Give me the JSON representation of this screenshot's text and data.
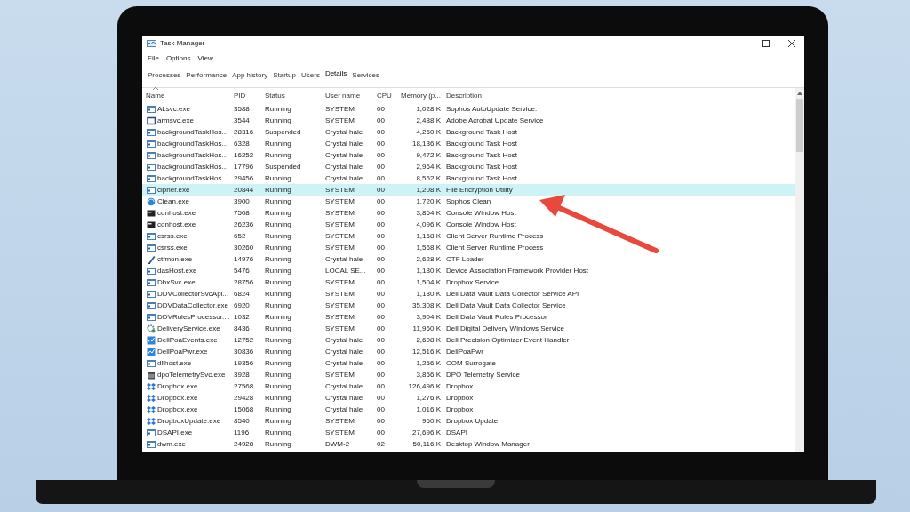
{
  "window": {
    "title": "Task Manager"
  },
  "menu": [
    "File",
    "Options",
    "View"
  ],
  "tabs": [
    {
      "label": "Processes",
      "selected": false
    },
    {
      "label": "Performance",
      "selected": false
    },
    {
      "label": "App history",
      "selected": false
    },
    {
      "label": "Startup",
      "selected": false
    },
    {
      "label": "Users",
      "selected": false
    },
    {
      "label": "Details",
      "selected": true
    },
    {
      "label": "Services",
      "selected": false
    }
  ],
  "columns": [
    {
      "label": "Name",
      "sorted": true
    },
    {
      "label": "PID",
      "sorted": false
    },
    {
      "label": "Status",
      "sorted": false
    },
    {
      "label": "User name",
      "sorted": false
    },
    {
      "label": "CPU",
      "sorted": false
    },
    {
      "label": "Memory (p...",
      "sorted": false
    },
    {
      "label": "Description",
      "sorted": false
    }
  ],
  "rows": [
    {
      "kind": "exe",
      "name": "ALsvc.exe",
      "pid": "3588",
      "status": "Running",
      "user": "SYSTEM",
      "cpu": "00",
      "memory": "1,028 K",
      "description": "Sophos AutoUpdate Service.",
      "selected": false
    },
    {
      "kind": "frame",
      "name": "armsvc.exe",
      "pid": "3544",
      "status": "Running",
      "user": "SYSTEM",
      "cpu": "00",
      "memory": "2,488 K",
      "description": "Adobe Acrobat Update Service",
      "selected": false
    },
    {
      "kind": "exe",
      "name": "backgroundTaskHos...",
      "pid": "28316",
      "status": "Suspended",
      "user": "Crystal hale",
      "cpu": "00",
      "memory": "4,260 K",
      "description": "Background Task Host",
      "selected": false
    },
    {
      "kind": "exe",
      "name": "backgroundTaskHos...",
      "pid": "6328",
      "status": "Running",
      "user": "Crystal hale",
      "cpu": "00",
      "memory": "18,136 K",
      "description": "Background Task Host",
      "selected": false
    },
    {
      "kind": "exe",
      "name": "backgroundTaskHos...",
      "pid": "16252",
      "status": "Running",
      "user": "Crystal hale",
      "cpu": "00",
      "memory": "9,472 K",
      "description": "Background Task Host",
      "selected": false
    },
    {
      "kind": "exe",
      "name": "backgroundTaskHos...",
      "pid": "17796",
      "status": "Suspended",
      "user": "Crystal hale",
      "cpu": "00",
      "memory": "2,964 K",
      "description": "Background Task Host",
      "selected": false
    },
    {
      "kind": "exe",
      "name": "backgroundTaskHos...",
      "pid": "29456",
      "status": "Running",
      "user": "Crystal hale",
      "cpu": "00",
      "memory": "8,552 K",
      "description": "Background Task Host",
      "selected": false
    },
    {
      "kind": "exe",
      "name": "cipher.exe",
      "pid": "20844",
      "status": "Running",
      "user": "SYSTEM",
      "cpu": "00",
      "memory": "1,208 K",
      "description": "File Encryption Utility",
      "selected": true
    },
    {
      "kind": "globe",
      "name": "Clean.exe",
      "pid": "3900",
      "status": "Running",
      "user": "SYSTEM",
      "cpu": "00",
      "memory": "1,720 K",
      "description": "Sophos Clean",
      "selected": false
    },
    {
      "kind": "console",
      "name": "conhost.exe",
      "pid": "7508",
      "status": "Running",
      "user": "SYSTEM",
      "cpu": "00",
      "memory": "3,864 K",
      "description": "Console Window Host",
      "selected": false
    },
    {
      "kind": "console",
      "name": "conhost.exe",
      "pid": "26236",
      "status": "Running",
      "user": "SYSTEM",
      "cpu": "00",
      "memory": "4,096 K",
      "description": "Console Window Host",
      "selected": false
    },
    {
      "kind": "exe",
      "name": "csrss.exe",
      "pid": "652",
      "status": "Running",
      "user": "SYSTEM",
      "cpu": "00",
      "memory": "1,168 K",
      "description": "Client Server Runtime Process",
      "selected": false
    },
    {
      "kind": "exe",
      "name": "csrss.exe",
      "pid": "30260",
      "status": "Running",
      "user": "SYSTEM",
      "cpu": "00",
      "memory": "1,568 K",
      "description": "Client Server Runtime Process",
      "selected": false
    },
    {
      "kind": "pen",
      "name": "ctfmon.exe",
      "pid": "14976",
      "status": "Running",
      "user": "Crystal hale",
      "cpu": "00",
      "memory": "2,628 K",
      "description": "CTF Loader",
      "selected": false
    },
    {
      "kind": "exe",
      "name": "dasHost.exe",
      "pid": "5476",
      "status": "Running",
      "user": "LOCAL SE...",
      "cpu": "00",
      "memory": "1,180 K",
      "description": "Device Association Framework Provider Host",
      "selected": false
    },
    {
      "kind": "exe",
      "name": "DbxSvc.exe",
      "pid": "28756",
      "status": "Running",
      "user": "SYSTEM",
      "cpu": "00",
      "memory": "1,504 K",
      "description": "Dropbox Service",
      "selected": false
    },
    {
      "kind": "exe",
      "name": "DDVCollectorSvcApi...",
      "pid": "6824",
      "status": "Running",
      "user": "SYSTEM",
      "cpu": "00",
      "memory": "1,180 K",
      "description": "Dell Data Vault Data Collector Service API",
      "selected": false
    },
    {
      "kind": "exe",
      "name": "DDVDataCollector.exe",
      "pid": "6920",
      "status": "Running",
      "user": "SYSTEM",
      "cpu": "00",
      "memory": "35,308 K",
      "description": "Dell Data Vault Data Collector Service",
      "selected": false
    },
    {
      "kind": "exe",
      "name": "DDVRulesProcessor....",
      "pid": "1032",
      "status": "Running",
      "user": "SYSTEM",
      "cpu": "00",
      "memory": "3,904 K",
      "description": "Dell Data Vault Rules Processor",
      "selected": false
    },
    {
      "kind": "gear",
      "name": "DeliveryService.exe",
      "pid": "8436",
      "status": "Running",
      "user": "SYSTEM",
      "cpu": "00",
      "memory": "11,960 K",
      "description": "Dell Digital Delivery Windows Service",
      "selected": false
    },
    {
      "kind": "chart",
      "name": "DellPoaEvents.exe",
      "pid": "12752",
      "status": "Running",
      "user": "Crystal hale",
      "cpu": "00",
      "memory": "2,608 K",
      "description": "Dell Precision Optimizer Event Handler",
      "selected": false
    },
    {
      "kind": "chart",
      "name": "DellPoaPwr.exe",
      "pid": "30836",
      "status": "Running",
      "user": "Crystal hale",
      "cpu": "00",
      "memory": "12,516 K",
      "description": "DellPoaPwr",
      "selected": false
    },
    {
      "kind": "exe",
      "name": "dllhost.exe",
      "pid": "19356",
      "status": "Running",
      "user": "Crystal hale",
      "cpu": "00",
      "memory": "1,256 K",
      "description": "COM Surrogate",
      "selected": false
    },
    {
      "kind": "calendar",
      "name": "dpoTelemetrySvc.exe",
      "pid": "3928",
      "status": "Running",
      "user": "SYSTEM",
      "cpu": "00",
      "memory": "3,856 K",
      "description": "DPO Telemetry Service",
      "selected": false
    },
    {
      "kind": "dropbox",
      "name": "Dropbox.exe",
      "pid": "27568",
      "status": "Running",
      "user": "Crystal hale",
      "cpu": "00",
      "memory": "126,496 K",
      "description": "Dropbox",
      "selected": false
    },
    {
      "kind": "dropbox",
      "name": "Dropbox.exe",
      "pid": "29428",
      "status": "Running",
      "user": "Crystal hale",
      "cpu": "00",
      "memory": "1,276 K",
      "description": "Dropbox",
      "selected": false
    },
    {
      "kind": "dropbox",
      "name": "Dropbox.exe",
      "pid": "15068",
      "status": "Running",
      "user": "Crystal hale",
      "cpu": "00",
      "memory": "1,016 K",
      "description": "Dropbox",
      "selected": false
    },
    {
      "kind": "dropbox",
      "name": "DropboxUpdate.exe",
      "pid": "8540",
      "status": "Running",
      "user": "SYSTEM",
      "cpu": "00",
      "memory": "960 K",
      "description": "Dropbox Update",
      "selected": false
    },
    {
      "kind": "exe",
      "name": "DSAPI.exe",
      "pid": "1196",
      "status": "Running",
      "user": "SYSTEM",
      "cpu": "00",
      "memory": "27,696 K",
      "description": "DSAPI",
      "selected": false
    },
    {
      "kind": "exe",
      "name": "dwm.exe",
      "pid": "24928",
      "status": "Running",
      "user": "DWM-2",
      "cpu": "02",
      "memory": "50,116 K",
      "description": "Desktop Window Manager",
      "selected": false
    }
  ]
}
